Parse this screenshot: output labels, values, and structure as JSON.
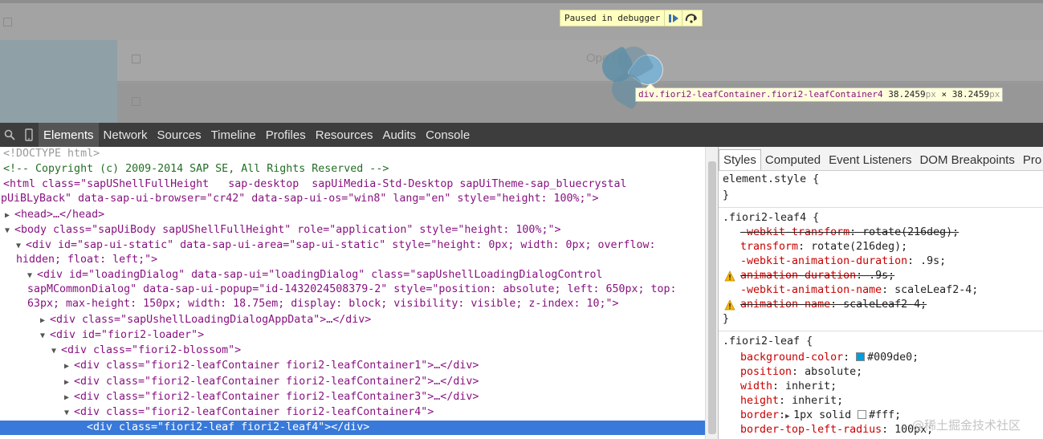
{
  "preview": {
    "ghost_text": "Ope    (1)",
    "debugger_banner": {
      "text": "Paused in debugger",
      "resume_icon": "resume-icon",
      "step_icon": "step-over-icon"
    },
    "tooltip": {
      "selector": "div.fiori2-leafContainer.fiori2-leafContainer4",
      "width": "38.2459",
      "height": "38.2459",
      "unit": "px",
      "times": "×"
    },
    "highlight_color": "#79b3d8"
  },
  "toolbar": {
    "tabs": [
      "Elements",
      "Network",
      "Sources",
      "Timeline",
      "Profiles",
      "Resources",
      "Audits",
      "Console"
    ],
    "active_tab": "Elements"
  },
  "elements": {
    "lines": [
      "<!DOCTYPE html>",
      "<!-- Copyright (c) 2009-2014 SAP SE, All Rights Reserved -->",
      "<html class=\"sapUShellFullHeight   sap-desktop  sapUiMedia-Std-Desktop sapUiTheme-sap_bluecrystal",
      "apUiBLyBack\" data-sap-ui-browser=\"cr42\" data-sap-ui-os=\"win8\" lang=\"en\" style=\"height: 100%;\">",
      "<head>…</head>",
      "<body class=\"sapUiBody sapUShellFullHeight\" role=\"application\" style=\"height: 100%;\">",
      "<div id=\"sap-ui-static\" data-sap-ui-area=\"sap-ui-static\" style=\"height: 0px; width: 0px; overflow:",
      "hidden; float: left;\">",
      "<div id=\"loadingDialog\" data-sap-ui=\"loadingDialog\" class=\"sapUshellLoadingDialogControl",
      "sapMCommonDialog\" data-sap-ui-popup=\"id-1432024508379-2\" style=\"position: absolute; left: 650px; top:",
      "63px; max-height: 150px; width: 18.75em; display: block; visibility: visible; z-index: 10;\">",
      "<div class=\"sapUshellLoadingDialogAppData\">…</div>",
      "<div id=\"fiori2-loader\">",
      "<div class=\"fiori2-blossom\">",
      "<div class=\"fiori2-leafContainer fiori2-leafContainer1\">…</div>",
      "<div class=\"fiori2-leafContainer fiori2-leafContainer2\">…</div>",
      "<div class=\"fiori2-leafContainer fiori2-leafContainer3\">…</div>",
      "<div class=\"fiori2-leafContainer fiori2-leafContainer4\">",
      "<div class=\"fiori2-leaf fiori2-leaf4\"></div>"
    ]
  },
  "sidebar": {
    "tabs": [
      "Styles",
      "Computed",
      "Event Listeners",
      "DOM Breakpoints",
      "Pro"
    ],
    "active_tab": "Styles",
    "rules": [
      {
        "selector": "element.style {",
        "close": "}"
      },
      {
        "selector": ".fiori2-leaf4 {",
        "close": "}",
        "props": [
          {
            "name": "-webkit-transform",
            "value": "rotate(216deg);"
          },
          {
            "name": "transform",
            "value": "rotate(216deg);"
          },
          {
            "name": "-webkit-animation-duration",
            "value": ".9s;"
          },
          {
            "name": "animation-duration",
            "value": ".9s;"
          },
          {
            "name": "-webkit-animation-name",
            "value": "scaleLeaf2-4;"
          },
          {
            "name": "animation-name",
            "value": "scaleLeaf2-4;"
          }
        ]
      },
      {
        "selector": ".fiori2-leaf {",
        "props": [
          {
            "name": "background-color",
            "value": "#009de0;",
            "swatch": "#009de0"
          },
          {
            "name": "position",
            "value": "absolute;"
          },
          {
            "name": "width",
            "value": "inherit;"
          },
          {
            "name": "height",
            "value": "inherit;"
          },
          {
            "name": "border",
            "value": "1px solid ",
            "value2": "#fff;",
            "swatch": "#ffffff"
          },
          {
            "name": "border-top-left-radius",
            "value": "100px;"
          }
        ]
      }
    ]
  },
  "watermark": "@稀土掘金技术社区"
}
